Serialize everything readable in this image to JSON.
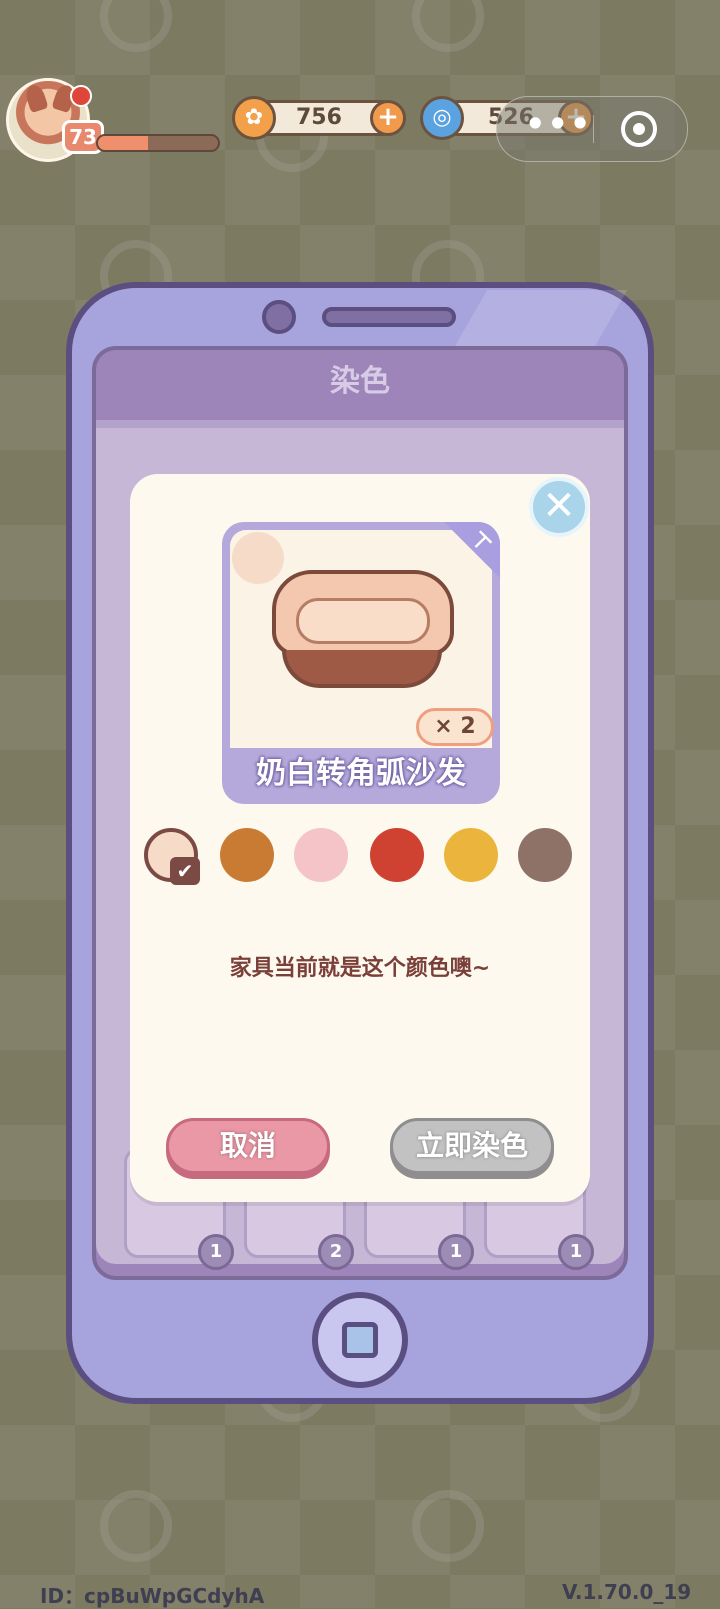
{
  "hud": {
    "level": "73",
    "xp_fraction": 0.42,
    "coins": "756",
    "gems": "526",
    "plus_label": "+",
    "menu_dots": "•••"
  },
  "phone_panel": {
    "title": "染色",
    "slots": [
      {
        "count": "1"
      },
      {
        "count": "2"
      },
      {
        "count": "1"
      },
      {
        "count": "1"
      }
    ]
  },
  "dye_dialog": {
    "close_label": "✕",
    "item_name": "奶白转角弧沙发",
    "quantity": "× 2",
    "colors": [
      "#f6dcc8",
      "#c97b34",
      "#f4c4c8",
      "#cf4232",
      "#ebb53d",
      "#8e7268"
    ],
    "selected_color_index": 0,
    "check_mark": "✔",
    "hint": "家具当前就是这个颜色噢~",
    "cancel_label": "取消",
    "dye_label": "立即染色"
  },
  "footer": {
    "id_text": "ID：cpBuWpGCdyhA",
    "version": "V.1.70.0_19"
  }
}
